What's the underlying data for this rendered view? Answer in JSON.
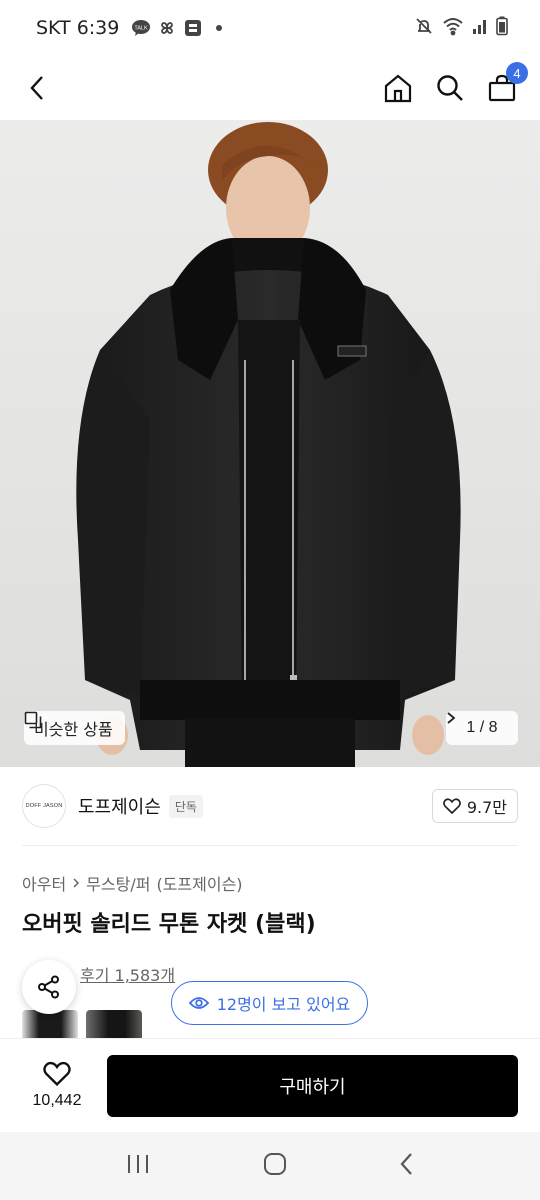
{
  "status_bar": {
    "carrier_time": "SKT 6:39",
    "talk_label": "TALK"
  },
  "header": {
    "cart_count": "4"
  },
  "hero": {
    "similar_label": "비슷한 상품",
    "page_indicator": "1 / 8"
  },
  "brand": {
    "logo_text": "DOFF JASON",
    "name": "도프제이슨",
    "tag": "단독",
    "likes": "9.7만"
  },
  "product": {
    "breadcrumb": [
      "아우터",
      "무스탕/퍼",
      "(도프제이슨)"
    ],
    "title": "오버핏 솔리드 무톤 자켓 (블랙)",
    "review_link": "후기 1,583개",
    "viewers": "12명이 보고 있어요"
  },
  "bottom_bar": {
    "wish_count": "10,442",
    "buy_label": "구매하기"
  },
  "colors": {
    "accent": "#3b6fe6",
    "buy_button": "#000000"
  }
}
